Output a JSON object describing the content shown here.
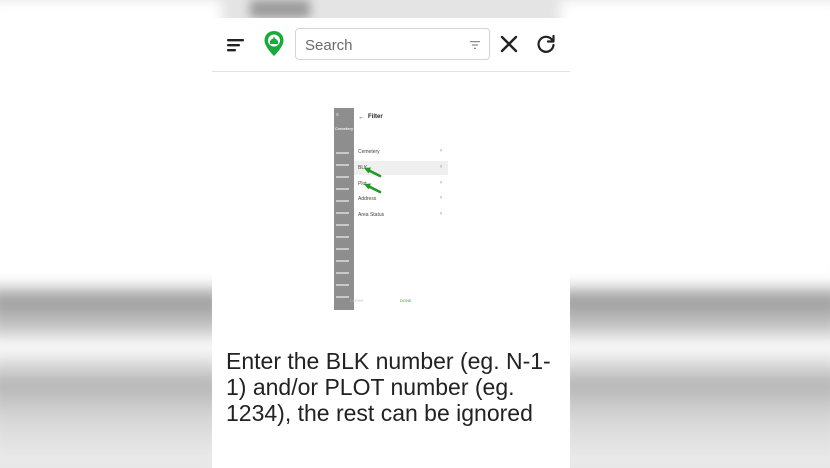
{
  "app_bar": {
    "search_placeholder": "Search",
    "icons": [
      "menu-icon",
      "location-pin-logo-icon",
      "filter-icon",
      "close-icon",
      "refresh-icon"
    ],
    "brand_color": "#1aaa3c"
  },
  "tutorial_screenshot": {
    "side_header": "Cemetery",
    "panel_title": "Filter",
    "rows": [
      {
        "label": "Cemetery"
      },
      {
        "label": "BLK"
      },
      {
        "label": "Plot"
      },
      {
        "label": "Address"
      },
      {
        "label": "Area Status"
      }
    ],
    "clear_label": "CLEAR",
    "done_label": "DONE",
    "arrow_color": "#1f9a22"
  },
  "instruction_text": "Enter the BLK number (eg. N-1-1) and/or PLOT number (eg. 1234), the rest can be ignored"
}
